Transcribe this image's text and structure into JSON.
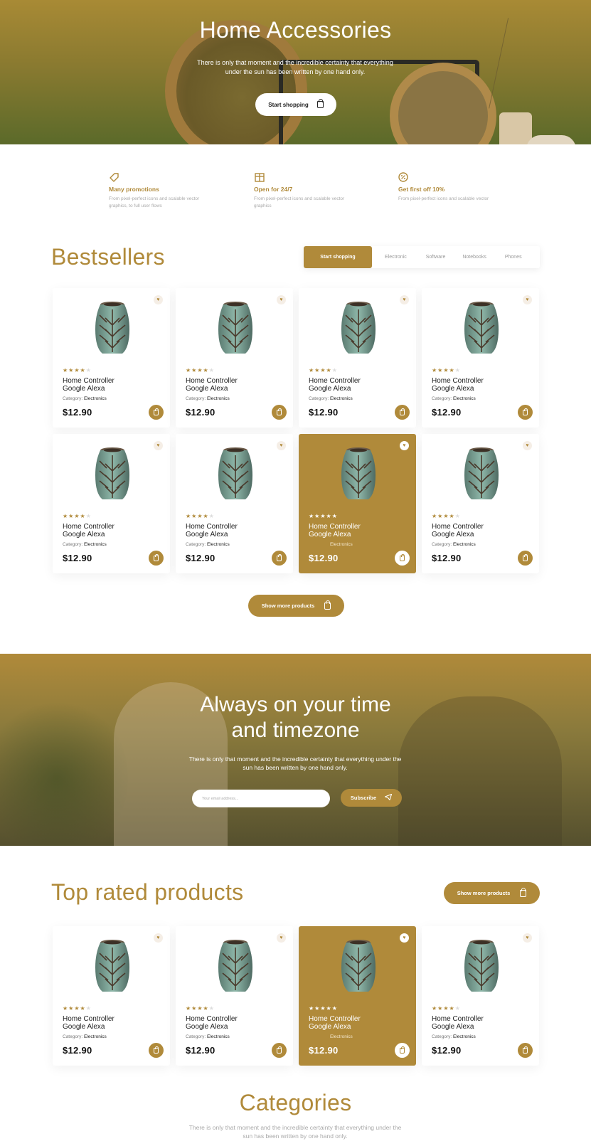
{
  "hero": {
    "title": "Home Accessories",
    "subtitle": "There is only that moment and the incredible certainty that everything under the sun has been written by one hand only.",
    "button": "Start shopping"
  },
  "features": [
    {
      "icon": "tag-icon",
      "title": "Many promotions",
      "desc": "From pixel-perfect icons and scalable vector graphics, to full user flows"
    },
    {
      "icon": "store-icon",
      "title": "Open for 24/7",
      "desc": "From pixel-perfect icons and scalable vector graphics"
    },
    {
      "icon": "percent-icon",
      "title": "Get first off 10%",
      "desc": "From pixel-perfect icons and scalable vector"
    }
  ],
  "bestsellers": {
    "title": "Bestsellers",
    "tabs": [
      "Start shopping",
      "Electronic",
      "Software",
      "Notebooks",
      "Phones"
    ],
    "show_more": "Show more products"
  },
  "product": {
    "name_line1": "Home Controller",
    "name_line2": "Google Alexa",
    "category_label": "Category:",
    "category": "Electronics",
    "price": "$12.90",
    "rating": 4,
    "rating_max": 5
  },
  "newsletter": {
    "title_line1": "Always on your time",
    "title_line2": "and timezone",
    "subtitle": "There is only that moment and the incredible certainty that everything under the sun has been written by one hand only.",
    "email_placeholder": "Your email address...",
    "button": "Subscribe"
  },
  "top_rated": {
    "title": "Top rated products",
    "show_more": "Show more products"
  },
  "categories": {
    "title": "Categories",
    "subtitle": "There is only that moment and the incredible certainty that everything under the sun has been written by one hand only."
  },
  "colors": {
    "accent": "#b08a3a",
    "text": "#222222",
    "muted": "#aaaaaa"
  }
}
